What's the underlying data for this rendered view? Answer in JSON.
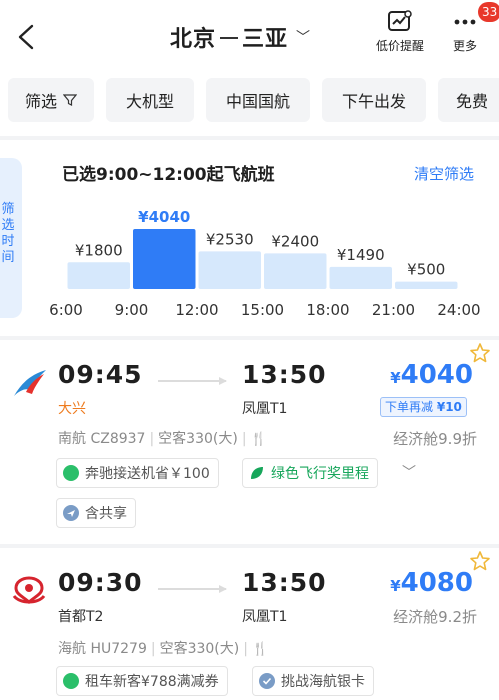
{
  "header": {
    "origin": "北京",
    "destination": "三亚",
    "price_alert_label": "低价提醒",
    "more_label": "更多",
    "badge_count": "33"
  },
  "filters": [
    "筛选",
    "大机型",
    "中国国航",
    "下午出发",
    "免费"
  ],
  "side_tab": [
    "筛",
    "选",
    "时",
    "间"
  ],
  "chart_header": {
    "title": "已选9:00~12:00起飞航班",
    "clear_label": "清空筛选"
  },
  "chart_data": {
    "type": "bar",
    "categories": [
      "6:00-9:00",
      "9:00-12:00",
      "12:00-15:00",
      "15:00-18:00",
      "18:00-21:00",
      "21:00-24:00"
    ],
    "values": [
      1800,
      4040,
      2530,
      2400,
      1490,
      500
    ],
    "value_labels": [
      "¥1800",
      "¥4040",
      "¥2530",
      "¥2400",
      "¥1490",
      "¥500"
    ],
    "tick_labels": [
      "6:00",
      "9:00",
      "12:00",
      "15:00",
      "18:00",
      "21:00",
      "24:00"
    ],
    "selected_index": 1,
    "ylim": [
      0,
      4040
    ],
    "grid": false
  },
  "flights": [
    {
      "dep_time": "09:45",
      "arr_time": "13:50",
      "dep_airport": "大兴",
      "arr_airport": "凤凰T1",
      "currency": "¥",
      "price": "4040",
      "discount_text": "下单再减",
      "discount_value": "¥10",
      "airline": "南航",
      "flight_no": "CZ8937",
      "aircraft": "空客330(大)",
      "meal_icon": "utensils-icon",
      "cabin": "经济舱9.9折",
      "tags": [
        "奔驰接送机省￥100",
        "绿色飞行奖里程",
        "含共享"
      ]
    },
    {
      "dep_time": "09:30",
      "arr_time": "13:50",
      "dep_airport": "首都T2",
      "arr_airport": "凤凰T1",
      "currency": "¥",
      "price": "4080",
      "airline": "海航",
      "flight_no": "HU7279",
      "aircraft": "空客330(大)",
      "meal_icon": "utensils-icon",
      "cabin": "经济舱9.2折",
      "tags": [
        "租车新客¥788满减券",
        "挑战海航银卡"
      ]
    }
  ],
  "colors": {
    "accent": "#2f7cf6",
    "bar_selected": "#2f7cf6",
    "bar_default": "#d6e8fc",
    "green": "#17a65b",
    "dep_orange": "#ee7b1e"
  }
}
